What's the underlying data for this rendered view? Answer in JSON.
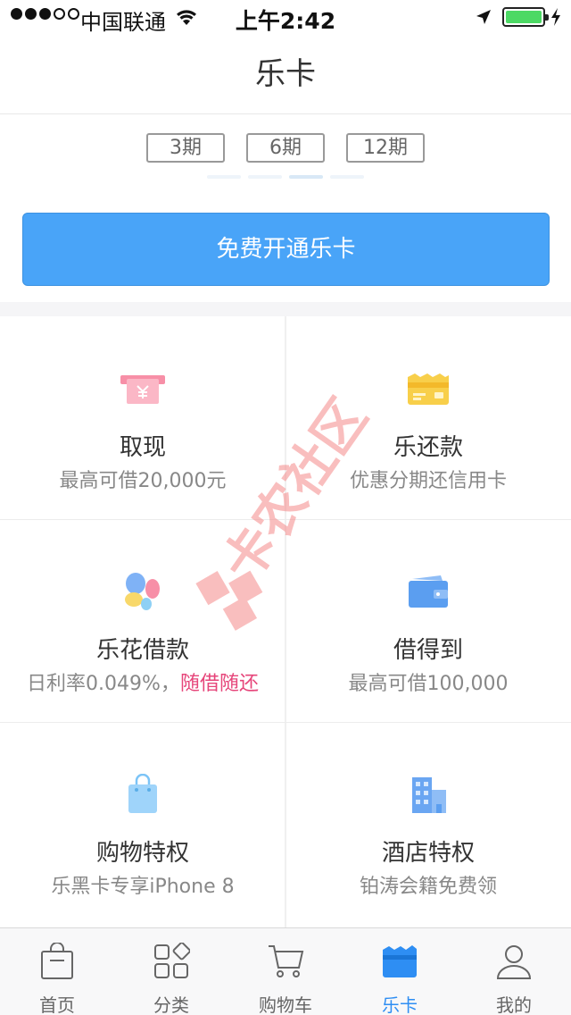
{
  "status_bar": {
    "carrier": "中国联通",
    "time": "上午2:42"
  },
  "nav": {
    "title": "乐卡"
  },
  "periods": [
    "3期",
    "6期",
    "12期"
  ],
  "cta": {
    "label": "免费开通乐卡"
  },
  "services": [
    {
      "title": "取现",
      "subtitle": "最高可借20,000元",
      "icon": "atm-card-icon",
      "color": "#f78fa7"
    },
    {
      "title": "乐还款",
      "subtitle": "优惠分期还信用卡",
      "icon": "credit-card-icon",
      "color": "#f8cf4a"
    },
    {
      "title": "乐花借款",
      "subtitle": "日利率0.049%，",
      "subtitle_highlight": "随借随还",
      "icon": "petals-icon",
      "color": "#f78fa7"
    },
    {
      "title": "借得到",
      "subtitle": "最高可借100,000",
      "icon": "wallet-icon",
      "color": "#5b9ef0"
    },
    {
      "title": "购物特权",
      "subtitle": "乐黑卡专享iPhone 8",
      "icon": "shopping-bag-icon",
      "color": "#7cc4f7"
    },
    {
      "title": "酒店特权",
      "subtitle": "铂涛会籍免费领",
      "icon": "hotel-icon",
      "color": "#6aa6f2"
    }
  ],
  "tabs": [
    {
      "label": "首页",
      "icon": "bag-icon"
    },
    {
      "label": "分类",
      "icon": "category-icon"
    },
    {
      "label": "购物车",
      "icon": "cart-icon"
    },
    {
      "label": "乐卡",
      "icon": "lecard-icon",
      "active": true
    },
    {
      "label": "我的",
      "icon": "user-icon"
    }
  ],
  "watermark": "卡农社区"
}
